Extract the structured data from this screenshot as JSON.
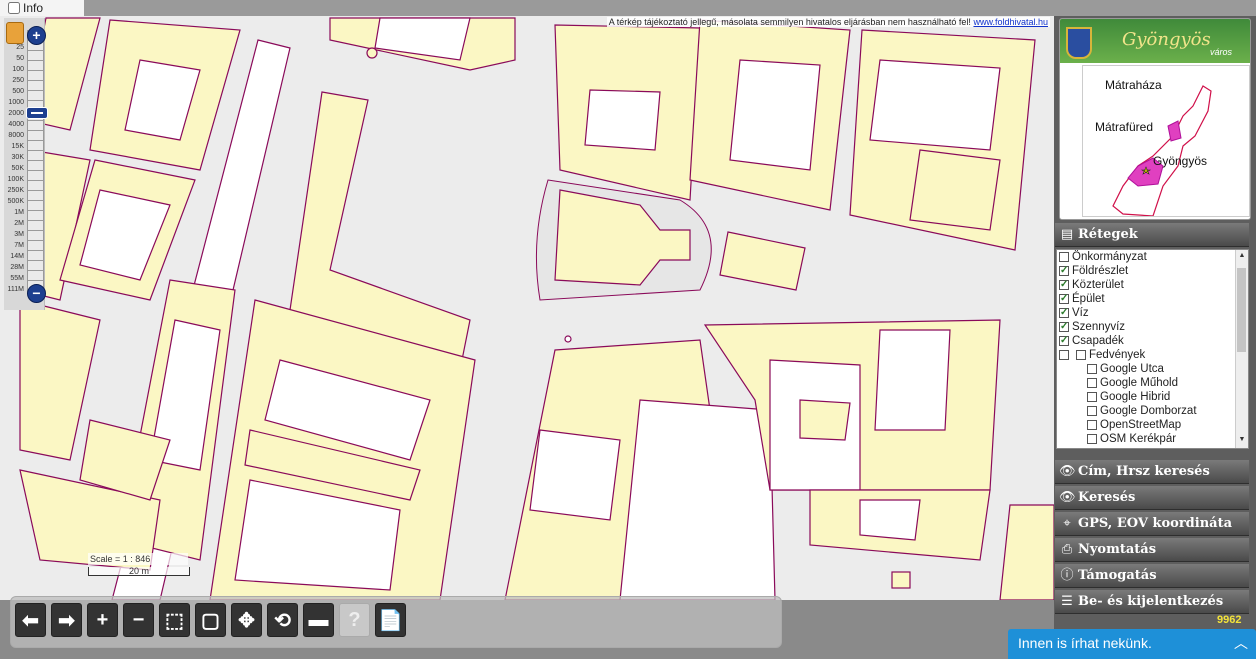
{
  "info": {
    "label": "Info"
  },
  "disclaimer": {
    "text": "A térkép tájékoztató jellegű, másolata semmilyen hivatalos eljárásban nem használható fel!",
    "link": "www.foldhivatal.hu"
  },
  "zoom": {
    "plus_icon": "plus-icon",
    "minus_icon": "minus-icon",
    "levels": [
      "25",
      "50",
      "100",
      "250",
      "500",
      "1000",
      "2000",
      "4000",
      "8000",
      "15K",
      "30K",
      "50K",
      "100K",
      "250K",
      "500K",
      "1M",
      "2M",
      "3M",
      "7M",
      "14M",
      "28M",
      "55M",
      "111M"
    ]
  },
  "scale": {
    "ratio": "Scale = 1 : 846",
    "bar_label": "20 m"
  },
  "toolbar": {
    "buttons": [
      {
        "name": "back-button",
        "icon": "arrow-left-icon",
        "glyph": "⬅"
      },
      {
        "name": "forward-button",
        "icon": "arrow-right-icon",
        "glyph": "➡"
      },
      {
        "name": "zoom-in-button",
        "icon": "plus-icon",
        "glyph": "+"
      },
      {
        "name": "zoom-out-button",
        "icon": "minus-icon",
        "glyph": "−"
      },
      {
        "name": "zoom-box-button",
        "icon": "zoom-box-icon",
        "glyph": "⬚"
      },
      {
        "name": "full-extent-button",
        "icon": "extent-icon",
        "glyph": "▢"
      },
      {
        "name": "pan-button",
        "icon": "pan-icon",
        "glyph": "✥"
      },
      {
        "name": "refresh-button",
        "icon": "refresh-icon",
        "glyph": "⟲"
      },
      {
        "name": "measure-button",
        "icon": "ruler-icon",
        "glyph": "▬"
      },
      {
        "name": "help-button",
        "icon": "question-icon",
        "glyph": "?",
        "disabled": true
      },
      {
        "name": "document-button",
        "icon": "document-icon",
        "glyph": "📄"
      }
    ]
  },
  "logo": {
    "city": "Gyöngyös",
    "suffix": "város",
    "towns": [
      "Mátraháza",
      "Mátrafüred",
      "Gyöngyös"
    ]
  },
  "layers_panel": {
    "title": "Rétegek",
    "icon": "layers-icon",
    "items": [
      {
        "label": "Önkormányzat",
        "checked": false,
        "indent": 0
      },
      {
        "label": "Földrészlet",
        "checked": true,
        "indent": 0
      },
      {
        "label": "Közterület",
        "checked": true,
        "indent": 0
      },
      {
        "label": "Épület",
        "checked": true,
        "indent": 0
      },
      {
        "label": "Víz",
        "checked": true,
        "indent": 0
      },
      {
        "label": "Szennyvíz",
        "checked": true,
        "indent": 0
      },
      {
        "label": "Csapadék",
        "checked": true,
        "indent": 0
      },
      {
        "label": "Fedvények",
        "checked": false,
        "indent": 1
      },
      {
        "label": "Google Utca",
        "checked": false,
        "indent": 2
      },
      {
        "label": "Google Műhold",
        "checked": false,
        "indent": 2
      },
      {
        "label": "Google Hibrid",
        "checked": false,
        "indent": 2
      },
      {
        "label": "Google Domborzat",
        "checked": false,
        "indent": 2
      },
      {
        "label": "OpenStreetMap",
        "checked": false,
        "indent": 2
      },
      {
        "label": "OSM Kerékpár",
        "checked": false,
        "indent": 2
      }
    ]
  },
  "sections": [
    {
      "label": "Cím, Hrsz keresés",
      "icon": "eye-icon",
      "glyph": "👁"
    },
    {
      "label": "Keresés",
      "icon": "eye-icon",
      "glyph": "👁"
    },
    {
      "label": "GPS, EOV koordináta",
      "icon": "crosshair-icon",
      "glyph": "⌖"
    },
    {
      "label": "Nyomtatás",
      "icon": "printer-icon",
      "glyph": "⎙"
    },
    {
      "label": "Támogatás",
      "icon": "info-icon",
      "glyph": "ⓘ"
    },
    {
      "label": "Be- és kijelentkezés",
      "icon": "login-icon",
      "glyph": "☰"
    }
  ],
  "counter": "9962",
  "chat": {
    "label": "Innen is írhat nekünk.",
    "icon": "chevron-up-icon"
  }
}
